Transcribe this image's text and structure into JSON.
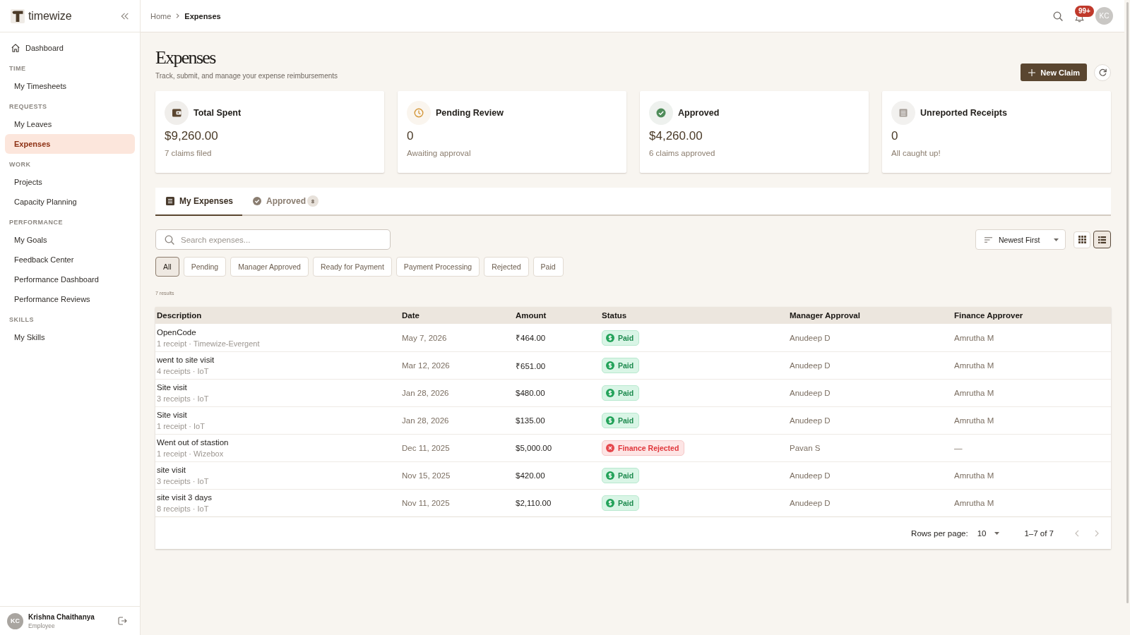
{
  "sidebar": {
    "brand": "timewize",
    "top_item": {
      "label": "Dashboard",
      "selected": false
    },
    "sections": [
      {
        "title": "TIME",
        "items": [
          {
            "label": "My Timesheets",
            "selected": false
          }
        ]
      },
      {
        "title": "REQUESTS",
        "items": [
          {
            "label": "My Leaves",
            "selected": false
          },
          {
            "label": "Expenses",
            "selected": true
          }
        ]
      },
      {
        "title": "WORK",
        "items": [
          {
            "label": "Projects",
            "selected": false
          },
          {
            "label": "Capacity Planning",
            "selected": false
          }
        ]
      },
      {
        "title": "PERFORMANCE",
        "items": [
          {
            "label": "My Goals",
            "selected": false
          },
          {
            "label": "Feedback Center",
            "selected": false
          },
          {
            "label": "Performance Dashboard",
            "selected": false
          },
          {
            "label": "Performance Reviews",
            "selected": false
          }
        ]
      },
      {
        "title": "SKILLS",
        "items": [
          {
            "label": "My Skills",
            "selected": false
          }
        ]
      }
    ],
    "user": {
      "initials": "KC",
      "name": "Krishna Chaithanya",
      "role": "Employee"
    }
  },
  "header": {
    "breadcrumb": [
      {
        "label": "Home",
        "current": false
      },
      {
        "label": "Expenses",
        "current": true
      }
    ],
    "notification_count": "99+",
    "avatar_initials": "KC"
  },
  "page": {
    "title": "Expenses",
    "subtitle": "Track, submit, and manage your expense reimbursements",
    "new_claim_label": "New Claim"
  },
  "stats": [
    {
      "kind": "total",
      "title": "Total Spent",
      "value": "$9,260.00",
      "note": "7 claims filed"
    },
    {
      "kind": "pending",
      "title": "Pending Review",
      "value": "0",
      "note": "Awaiting approval"
    },
    {
      "kind": "approved",
      "title": "Approved",
      "value": "$4,260.00",
      "note": "6 claims approved"
    },
    {
      "kind": "unreported",
      "title": "Unreported Receipts",
      "value": "0",
      "note": "All caught up!"
    }
  ],
  "tabs": [
    {
      "kind": "list",
      "label": "My Expenses",
      "selected": true
    },
    {
      "kind": "approved",
      "label": "Approved",
      "selected": false,
      "badge": "8"
    }
  ],
  "search": {
    "placeholder": "Search expenses..."
  },
  "sort": {
    "label": "Newest First"
  },
  "view_toggle": [
    {
      "kind": "grid",
      "selected": false
    },
    {
      "kind": "list",
      "selected": true
    }
  ],
  "filters": [
    {
      "label": "All",
      "selected": true
    },
    {
      "label": "Pending",
      "selected": false
    },
    {
      "label": "Manager Approved",
      "selected": false
    },
    {
      "label": "Ready for Payment",
      "selected": false
    },
    {
      "label": "Payment Processing",
      "selected": false
    },
    {
      "label": "Rejected",
      "selected": false
    },
    {
      "label": "Paid",
      "selected": false
    }
  ],
  "results_count": "7 results",
  "table": {
    "columns": [
      "Description",
      "Date",
      "Amount",
      "Status",
      "Manager Approval",
      "Finance Approver"
    ],
    "rows": [
      {
        "description": "OpenCode",
        "details": "1 receipt · Timewize-Evergent",
        "date": "May 7, 2026",
        "amount": "₹464.00",
        "status": {
          "kind": "paid",
          "label": "Paid"
        },
        "manager_approval": "Anudeep D",
        "finance_approver": "Amrutha M"
      },
      {
        "description": "went to site visit",
        "details": "4 receipts · IoT",
        "date": "Mar 12, 2026",
        "amount": "₹651.00",
        "status": {
          "kind": "paid",
          "label": "Paid"
        },
        "manager_approval": "Anudeep D",
        "finance_approver": "Amrutha M"
      },
      {
        "description": "Site visit",
        "details": "3 receipts · IoT",
        "date": "Jan 28, 2026",
        "amount": "$480.00",
        "status": {
          "kind": "paid",
          "label": "Paid"
        },
        "manager_approval": "Anudeep D",
        "finance_approver": "Amrutha M"
      },
      {
        "description": "Site visit",
        "details": "1 receipt · IoT",
        "date": "Jan 28, 2026",
        "amount": "$135.00",
        "status": {
          "kind": "paid",
          "label": "Paid"
        },
        "manager_approval": "Anudeep D",
        "finance_approver": "Amrutha M"
      },
      {
        "description": "Went out of stastion",
        "details": "1 receipt · Wizebox",
        "date": "Dec 11, 2025",
        "amount": "$5,000.00",
        "status": {
          "kind": "rejected",
          "label": "Finance Rejected"
        },
        "manager_approval": "Pavan S",
        "finance_approver": "—"
      },
      {
        "description": "site visit",
        "details": "3 receipts · IoT",
        "date": "Nov 15, 2025",
        "amount": "$420.00",
        "status": {
          "kind": "paid",
          "label": "Paid"
        },
        "manager_approval": "Anudeep D",
        "finance_approver": "Amrutha M"
      },
      {
        "description": "site visit 3 days",
        "details": "8 receipts · IoT",
        "date": "Nov 11, 2025",
        "amount": "$2,110.00",
        "status": {
          "kind": "paid",
          "label": "Paid"
        },
        "manager_approval": "Anudeep D",
        "finance_approver": "Amrutha M"
      }
    ]
  },
  "pagination": {
    "rows_per_page_label": "Rows per page:",
    "rows_per_page": "10",
    "range": "1–7 of 7",
    "buttons": [
      {
        "kind": "previous",
        "disabled": true
      },
      {
        "kind": "next",
        "disabled": true
      }
    ]
  }
}
